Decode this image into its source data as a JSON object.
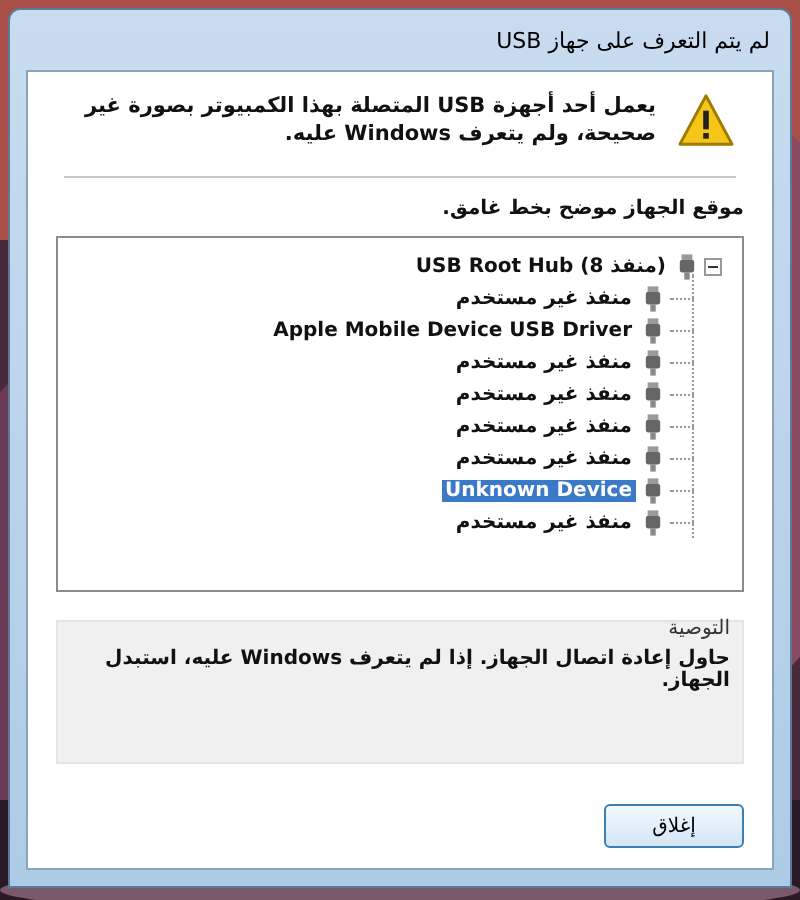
{
  "window": {
    "title": "لم يتم التعرف على جهاز USB"
  },
  "message": "يعمل أحد أجهزة USB المتصلة بهذا الكمبيوتر بصورة غير صحيحة، ولم يتعرف Windows عليه.",
  "tree_label": "موقع الجهاز موضح بخط غامق.",
  "tree": {
    "label": "USB Root Hub (8 منفذ)",
    "expanded": true,
    "selected": false,
    "children": [
      {
        "label": "منفذ غير مستخدم",
        "selected": false
      },
      {
        "label": "Apple Mobile Device USB Driver",
        "selected": false
      },
      {
        "label": "منفذ غير مستخدم",
        "selected": false
      },
      {
        "label": "منفذ غير مستخدم",
        "selected": false
      },
      {
        "label": "منفذ غير مستخدم",
        "selected": false
      },
      {
        "label": "منفذ غير مستخدم",
        "selected": false
      },
      {
        "label": "Unknown Device",
        "selected": true
      },
      {
        "label": "منفذ غير مستخدم",
        "selected": false
      }
    ]
  },
  "recommendation": {
    "heading": "التوصية",
    "text": "حاول إعادة اتصال الجهاز. إذا لم يتعرف Windows عليه، استبدل الجهاز."
  },
  "buttons": [
    "إغلاق"
  ]
}
